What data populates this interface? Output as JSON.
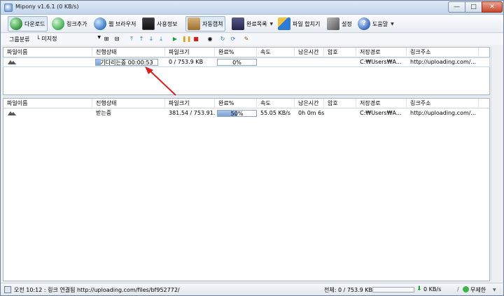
{
  "window": {
    "title": "Mipony v1.6.1 (0 KB/s)",
    "buttons": {
      "minimize": "—",
      "maximize": "□",
      "close": "✕"
    }
  },
  "toolbar": {
    "items": [
      {
        "label": "다운로드",
        "icon": "download-globe-icon",
        "pressed": true,
        "color": "#2e8b3d"
      },
      {
        "label": "링크추가",
        "icon": "add-link-icon",
        "pressed": false,
        "color": "#3aa84a"
      },
      {
        "label": "웹 브라우저",
        "icon": "web-browser-globe-icon",
        "pressed": false,
        "color": "#2f6fc2"
      },
      {
        "label": "사용정보",
        "icon": "usage-chart-icon",
        "pressed": false,
        "color": "#2b2b2b"
      },
      {
        "label": "자동캡쳐",
        "icon": "clipboard-capture-icon",
        "pressed": true,
        "color": "#b08040"
      },
      {
        "label": "완료목록",
        "icon": "completed-list-icon",
        "pressed": false,
        "dropdown": true,
        "color": "#3b3b6b"
      },
      {
        "label": "파일 합치기",
        "icon": "file-join-icon",
        "pressed": false,
        "color": "#2e7bd6"
      },
      {
        "label": "설정",
        "icon": "settings-tools-icon",
        "pressed": false,
        "color": "#666666"
      },
      {
        "label": "도움말",
        "icon": "help-icon",
        "pressed": false,
        "dropdown": true,
        "color": "#2f63b8"
      }
    ]
  },
  "groupbar": {
    "label": "그룹분류",
    "selected": "미지정",
    "prefix": "└"
  },
  "columns": [
    "파일이름",
    "진행상태",
    "파일크기",
    "완료%",
    "속도",
    "남은시간",
    "암호",
    "저장경로",
    "링크주소"
  ],
  "top_list": {
    "rows": [
      {
        "name": "",
        "status": "기다리는중 00:00:53",
        "size": "0 / 753.9 KB",
        "percent": "0%",
        "percent_value": 0,
        "speed": "",
        "remaining": "",
        "password": "",
        "path": "C:₩Users₩A...",
        "link": "http://uploading.com/..."
      }
    ]
  },
  "bottom_list": {
    "rows": [
      {
        "name": "",
        "status": "받는중",
        "size": "381.54 / 753.91...",
        "percent": "50%",
        "percent_value": 50,
        "speed": "55.05 KB/s",
        "remaining": "0h 0m 6s",
        "password": "",
        "path": "C:₩Users₩A...",
        "link": "http://uploading.com/..."
      }
    ]
  },
  "statusbar": {
    "message": "오전 10:12 : 링크 연결됨 http://uploading.com/files/bf952772/",
    "total": "전체: 0 / 753.9 KB",
    "speed": "0 KB/s",
    "limit": "무제한"
  },
  "colors": {
    "annotation_arrow": "#d32020",
    "progress_fill": "#7ea3d8"
  }
}
